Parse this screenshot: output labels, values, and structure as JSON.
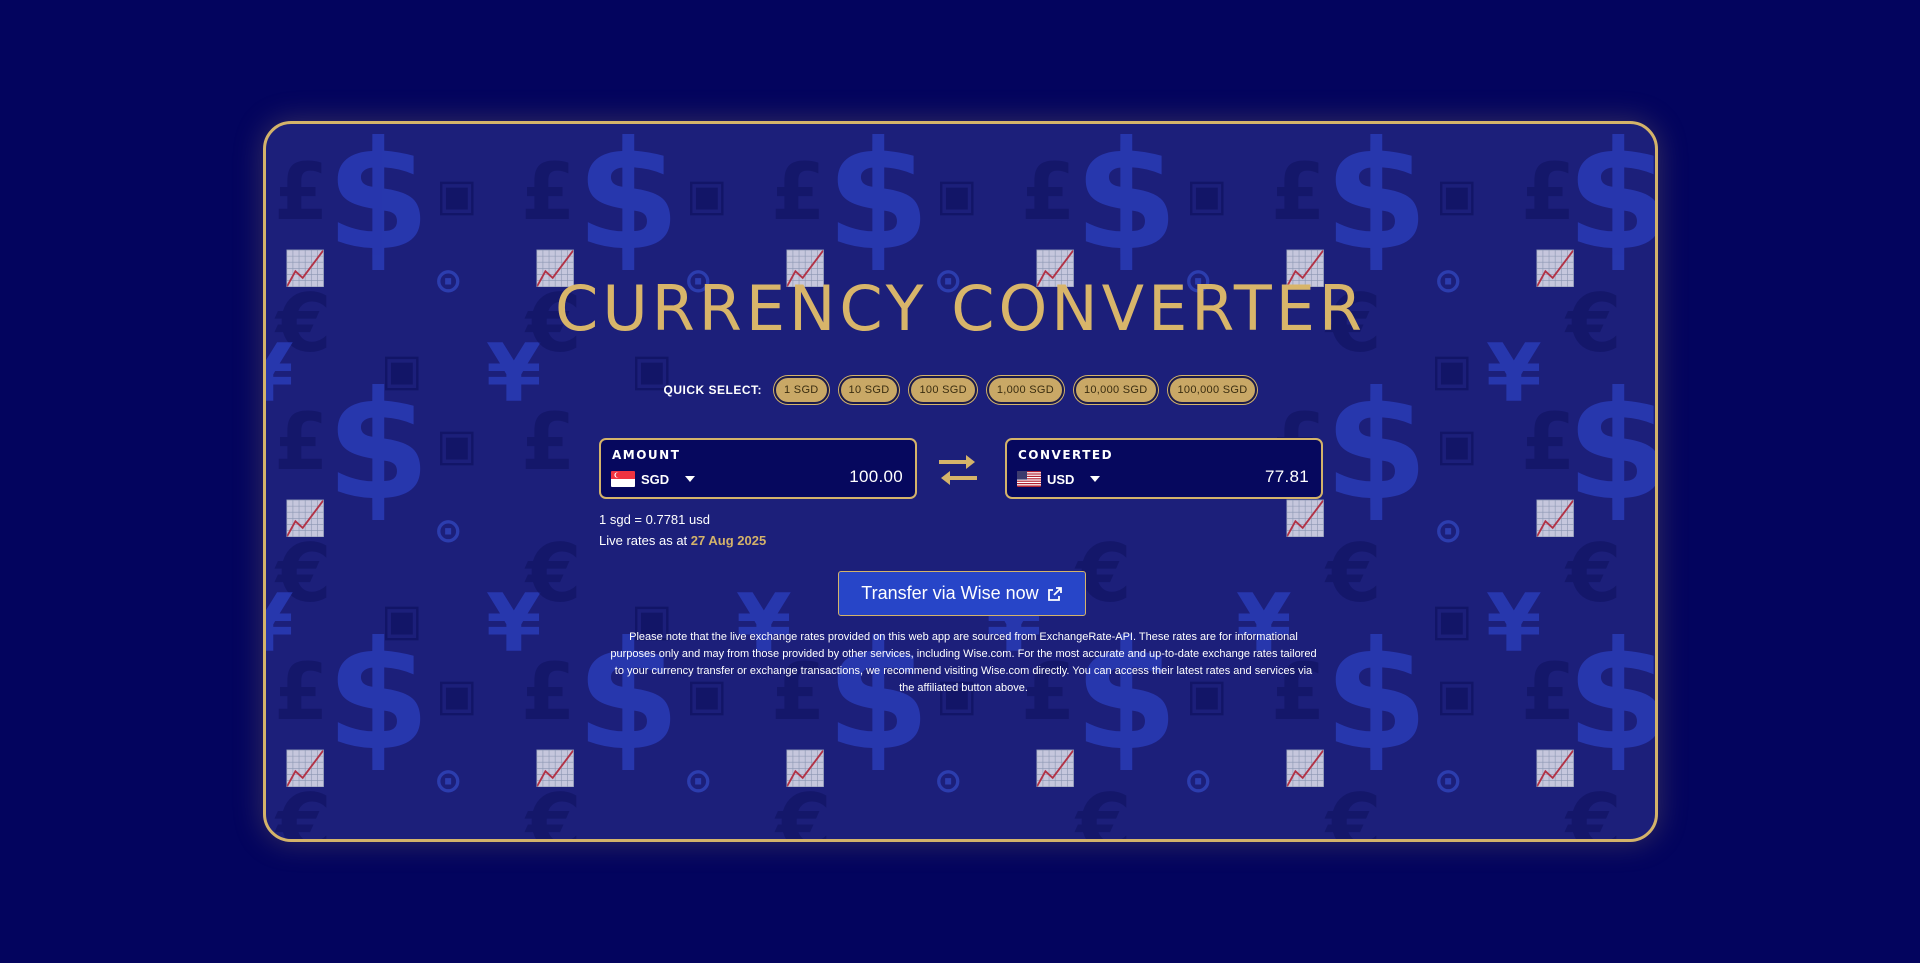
{
  "app": {
    "title": "CURRENCY CONVERTER"
  },
  "quick_select": {
    "label": "QUICK SELECT:",
    "options": [
      "1 SGD",
      "10 SGD",
      "100 SGD",
      "1,000 SGD",
      "10,000 SGD",
      "100,000 SGD"
    ]
  },
  "amount": {
    "label": "AMOUNT",
    "currency": "SGD",
    "value": "100.00",
    "flag_icon": "singapore-flag-icon"
  },
  "converted": {
    "label": "CONVERTED",
    "currency": "USD",
    "value": "77.81",
    "flag_icon": "us-flag-icon"
  },
  "rate": {
    "text": "1 sgd = 0.7781 usd",
    "live_label": "Live rates as at",
    "date": "27 Aug 2025"
  },
  "transfer_button": {
    "label": "Transfer via Wise now",
    "icon": "external-link-icon"
  },
  "disclaimer": "Please note that the live exchange rates provided on this web app are sourced from ExchangeRate-API. These rates are for informational purposes only and may from those provided by other services, including Wise.com. For the most accurate and up-to-date exchange rates tailored to your currency transfer or exchange transactions, we recommend visiting Wise.com directly. You can access their latest rates and services via the affiliated button above.",
  "colors": {
    "page_background": "#03045e",
    "card_background": "#1c1f7a",
    "accent_gold": "#d4b36a",
    "button_blue": "#2745c8"
  },
  "background_icons": [
    "dollar-icon",
    "pound-icon",
    "euro-icon",
    "yen-icon",
    "chart-icon",
    "coin-icon",
    "banknote-icon"
  ]
}
